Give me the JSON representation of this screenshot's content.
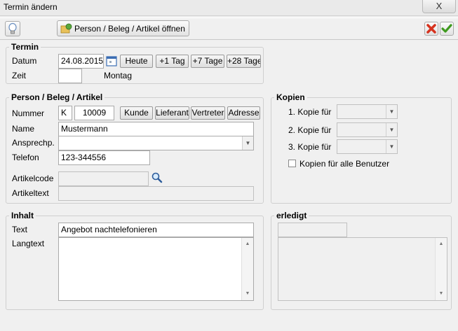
{
  "window": {
    "title": "Termin ändern",
    "close_glyph": "X"
  },
  "toolbar": {
    "open_button_label": "Person / Beleg / Artikel öffnen"
  },
  "termin": {
    "title": "Termin",
    "datum_label": "Datum",
    "datum_value": "24.08.2015",
    "heute": "Heute",
    "plus1": "+1 Tag",
    "plus7": "+7 Tage",
    "plus28": "+28 Tage",
    "zeit_label": "Zeit",
    "zeit_value": "",
    "weekday": "Montag"
  },
  "person": {
    "title": "Person / Beleg / Artikel",
    "nummer_label": "Nummer",
    "nummer_type": "K",
    "nummer_value": "10009",
    "kunde": "Kunde",
    "lieferant": "Lieferant",
    "vertreter": "Vertreter",
    "adresse": "Adresse",
    "name_label": "Name",
    "name_value": "Mustermann",
    "ansprech_label": "Ansprechp.",
    "ansprech_value": "",
    "telefon_label": "Telefon",
    "telefon_value": "123-344556",
    "artikelcode_label": "Artikelcode",
    "artikelcode_value": "",
    "artikeltext_label": "Artikeltext",
    "artikeltext_value": ""
  },
  "kopien": {
    "title": "Kopien",
    "kopie1": "1. Kopie für",
    "kopie2": "2. Kopie für",
    "kopie3": "3. Kopie für",
    "alle": "Kopien für alle Benutzer"
  },
  "inhalt": {
    "title": "Inhalt",
    "text_label": "Text",
    "text_value": "Angebot nachtelefonieren",
    "langtext_label": "Langtext",
    "langtext_value": ""
  },
  "erledigt": {
    "title": "erledigt",
    "value": "",
    "notes": ""
  },
  "colors": {
    "cancel": "#d6321e",
    "confirm": "#3f9a1f",
    "calendar": "#3b6db3"
  }
}
